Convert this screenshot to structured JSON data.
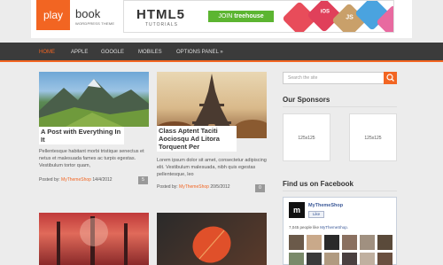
{
  "header": {
    "logo_left": "play",
    "logo_right": "book",
    "logo_tagline": "WORDPRESS THEME",
    "ad_brand": "HTML5",
    "ad_subtitle": "TUTORIALS",
    "ad_join_prefix": "JOIN",
    "ad_join_brand": "treehouse",
    "ad_badges": [
      "iOS",
      "JS"
    ]
  },
  "nav": {
    "items": [
      {
        "label": "HOME",
        "active": true
      },
      {
        "label": "APPLE",
        "active": false
      },
      {
        "label": "GOOGLE",
        "active": false
      },
      {
        "label": "MOBILES",
        "active": false
      },
      {
        "label": "OPTIONS PANEL »",
        "active": false
      }
    ]
  },
  "posts": [
    {
      "title": "A Post with Everything In It",
      "excerpt": "Pellentesque habitant morbi tristique senectus et netus et malesuada fames ac turpis egestas. Vestibulum tortor quam,",
      "meta_prefix": "Posted by:",
      "author": "MyThemeShop",
      "date": "14/4/2012",
      "comments": "5"
    },
    {
      "title": "Class Aptent Taciti Aociosqu Ad Litora Torquent Per",
      "excerpt": "Lorem ipsum dolor sit amet, consectetur adipiscing elit. Vestibulum malesuada, nibh quis egestas pellentesque, leo",
      "meta_prefix": "Posted by:",
      "author": "MyThemeShop",
      "date": "20/5/2012",
      "comments": "0"
    }
  ],
  "sidebar": {
    "search_placeholder": "Search the site",
    "sponsors_title": "Our Sponsors",
    "sponsor_label": "125x125",
    "facebook_title": "Find us on Facebook",
    "fb_page_name": "MyThemeShop",
    "fb_like": "Like",
    "fb_count_text": "7,045 people like",
    "fb_count_link": "MyThemeShop."
  },
  "colors": {
    "accent": "#f26522",
    "nav_bg": "#3b3b3b",
    "page_bg": "#ececec",
    "fb_blue": "#3b5998"
  }
}
